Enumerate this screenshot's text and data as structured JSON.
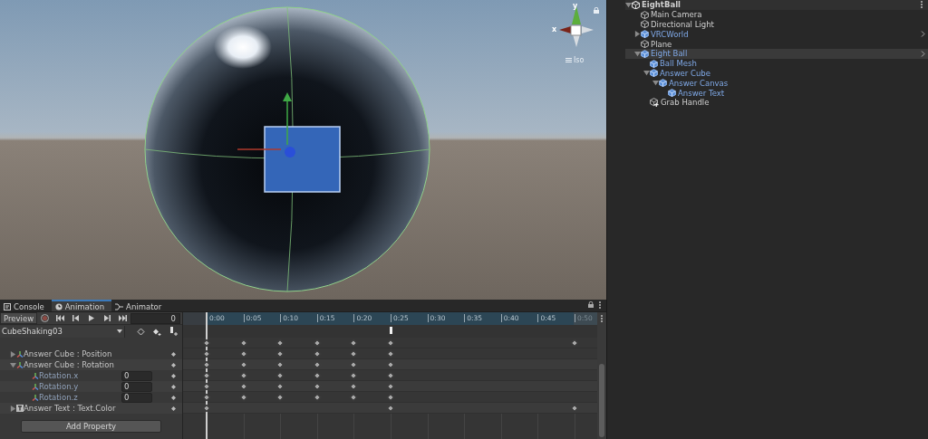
{
  "scene_view": {
    "gizmo": {
      "y_label": "y",
      "x_label": "x",
      "projection": "Iso"
    }
  },
  "animation_window": {
    "tabs": [
      {
        "label": "Console",
        "kind": "console",
        "selected": false
      },
      {
        "label": "Animation",
        "kind": "animation",
        "selected": true
      },
      {
        "label": "Animator",
        "kind": "animator",
        "selected": false
      }
    ],
    "toolbar": {
      "preview": "Preview",
      "recording": false,
      "frame": "0"
    },
    "clip": "CubeShaking03",
    "ticks": [
      {
        "label": "0:00",
        "playhead": true,
        "marker": false,
        "dimmed": false
      },
      {
        "label": "0:05",
        "playhead": false,
        "marker": false,
        "dimmed": false
      },
      {
        "label": "0:10",
        "playhead": false,
        "marker": false,
        "dimmed": false
      },
      {
        "label": "0:15",
        "playhead": false,
        "marker": false,
        "dimmed": false
      },
      {
        "label": "0:20",
        "playhead": false,
        "marker": false,
        "dimmed": false
      },
      {
        "label": "0:25",
        "playhead": false,
        "marker": true,
        "dimmed": false
      },
      {
        "label": "0:30",
        "playhead": false,
        "marker": false,
        "dimmed": false
      },
      {
        "label": "0:35",
        "playhead": false,
        "marker": false,
        "dimmed": false
      },
      {
        "label": "0:40",
        "playhead": false,
        "marker": false,
        "dimmed": false
      },
      {
        "label": "0:45",
        "playhead": false,
        "marker": false,
        "dimmed": false
      },
      {
        "label": "0:50",
        "playhead": false,
        "marker": false,
        "dimmed": true
      }
    ],
    "summary_keys": [
      true,
      true,
      true,
      true,
      true,
      true,
      false,
      false,
      false,
      false,
      true
    ],
    "tracks": [
      {
        "label": "Answer Cube : Position",
        "kind": "transform",
        "expanded": false,
        "keys": [
          true,
          true,
          true,
          true,
          true,
          true,
          false,
          false,
          false,
          false,
          false
        ]
      },
      {
        "label": "Answer Cube : Rotation",
        "kind": "transform",
        "expanded": true,
        "keys": [
          true,
          true,
          true,
          true,
          true,
          true,
          false,
          false,
          false,
          false,
          false
        ],
        "children": [
          {
            "label": "Rotation.x",
            "kind": "transform",
            "value": "0",
            "keys": [
              true,
              true,
              true,
              true,
              true,
              true,
              false,
              false,
              false,
              false,
              false
            ]
          },
          {
            "label": "Rotation.y",
            "kind": "transform",
            "value": "0",
            "keys": [
              true,
              true,
              true,
              true,
              true,
              true,
              false,
              false,
              false,
              false,
              false
            ]
          },
          {
            "label": "Rotation.z",
            "kind": "transform",
            "value": "0",
            "keys": [
              true,
              true,
              true,
              true,
              true,
              true,
              false,
              false,
              false,
              false,
              false
            ]
          }
        ]
      },
      {
        "label": "Answer Text : Text.Color",
        "kind": "text",
        "expanded": false,
        "keys": [
          true,
          false,
          false,
          false,
          false,
          true,
          false,
          false,
          false,
          false,
          true
        ]
      }
    ],
    "add_button": "Add Property"
  },
  "hierarchy": {
    "scene": {
      "label": "EightBall",
      "kind": "scene",
      "expanded": true,
      "children": [
        {
          "label": "Main Camera",
          "kind": "cube",
          "prefab": false,
          "selected": false,
          "chevron": false
        },
        {
          "label": "Directional Light",
          "kind": "cube",
          "prefab": false,
          "selected": false,
          "chevron": false
        },
        {
          "label": "VRCWorld",
          "kind": "cube",
          "expanded": false,
          "prefab": true,
          "selected": false,
          "chevron": true
        },
        {
          "label": "Plane",
          "kind": "cube",
          "prefab": false,
          "selected": false,
          "chevron": false
        },
        {
          "label": "Eight Ball",
          "kind": "cube",
          "expanded": true,
          "prefab": true,
          "selected": true,
          "chevron": true,
          "children": [
            {
              "label": "Ball Mesh",
              "kind": "cube",
              "prefab": true,
              "selected": false,
              "chevron": false
            },
            {
              "label": "Answer Cube",
              "kind": "cube",
              "expanded": true,
              "prefab": true,
              "selected": false,
              "chevron": false,
              "children": [
                {
                  "label": "Answer Canvas",
                  "kind": "cube",
                  "expanded": true,
                  "prefab": true,
                  "selected": false,
                  "chevron": false,
                  "children": [
                    {
                      "label": "Answer Text",
                      "kind": "cube",
                      "prefab": true,
                      "selected": false,
                      "chevron": false
                    }
                  ]
                }
              ]
            },
            {
              "label": "Grab Handle",
              "kind": "cube-badge",
              "prefab": false,
              "selected": false,
              "chevron": false
            }
          ]
        }
      ]
    }
  }
}
